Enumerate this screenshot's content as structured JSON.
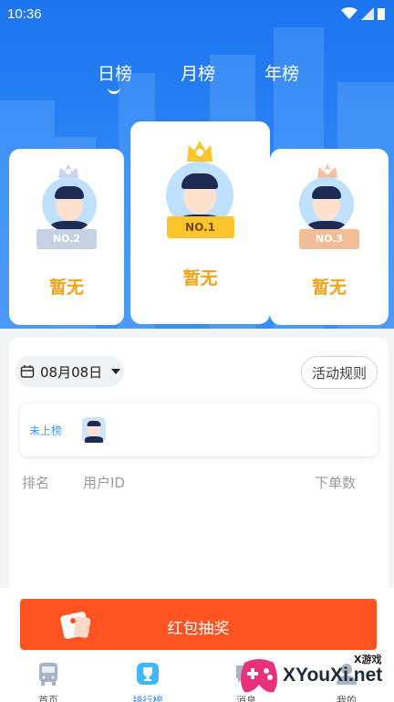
{
  "status_bar": {
    "time": "10:36"
  },
  "tabs": [
    {
      "label": "日榜",
      "active": true
    },
    {
      "label": "月榜",
      "active": false
    },
    {
      "label": "年榜",
      "active": false
    }
  ],
  "podium": {
    "first": {
      "badge": "NO.1",
      "label": "暂无"
    },
    "second": {
      "badge": "NO.2",
      "label": "暂无"
    },
    "third": {
      "badge": "NO.3",
      "label": "暂无"
    }
  },
  "filter": {
    "date": "08月08日",
    "rules_label": "活动规则"
  },
  "my_rank": {
    "status": "未上榜"
  },
  "table": {
    "headers": [
      "排名",
      "用户ID",
      "下单数"
    ]
  },
  "red_packet": {
    "label": "红包抽奖"
  },
  "bottom_nav": [
    {
      "label": "首页",
      "icon": "bus-icon",
      "active": false
    },
    {
      "label": "排行榜",
      "icon": "trophy-icon",
      "active": true
    },
    {
      "label": "消息",
      "icon": "message-icon",
      "active": false
    },
    {
      "label": "我的",
      "icon": "user-icon",
      "active": false
    }
  ],
  "watermark": {
    "site": "XYouXi.net",
    "tag": "X游戏"
  },
  "colors": {
    "primary_blue": "#2f86f5",
    "gold": "#f3a313",
    "red_button": "#ff5322"
  }
}
